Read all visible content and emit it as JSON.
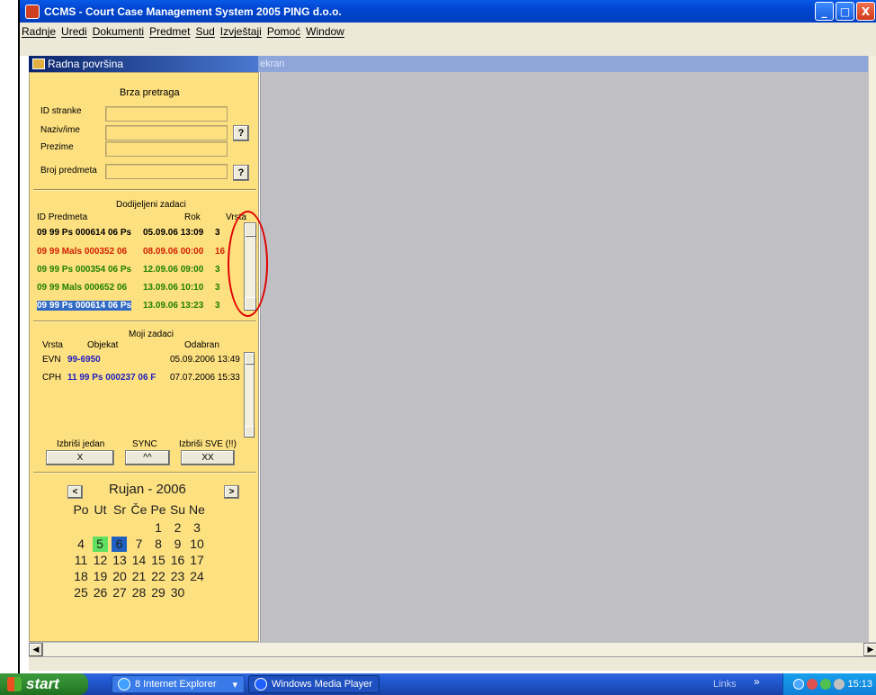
{
  "window": {
    "title": "CCMS - Court Case Management System 2005 PING d.o.o.",
    "minimize_glyph": "_",
    "maximize_glyph": "□",
    "close_glyph": "X"
  },
  "menu": [
    "Radnje",
    "Uredi",
    "Dokumenti",
    "Predmet",
    "Sud",
    "Izvještaji",
    "Pomoć",
    "Window"
  ],
  "panel": {
    "title": "Radna površina",
    "workspace_title": "ekran",
    "quick_search": {
      "heading": "Brza pretraga",
      "id_label": "ID stranke",
      "name_label": "Naziv/ime",
      "surname_label": "Prezime",
      "case_label": "Broj predmeta",
      "help_glyph": "?"
    },
    "assigned": {
      "heading": "Dodijeljeni zadaci",
      "col_id": "ID Predmeta",
      "col_deadline": "Rok",
      "col_type": "Vrsta",
      "rows": [
        {
          "id": "09 99 Ps 000614 06 Ps",
          "deadline": "05.09.06 13:09",
          "type": "3",
          "color": "#000000"
        },
        {
          "id": "09 99 Mals 000352 06",
          "deadline": "08.09.06 00:00",
          "type": "16",
          "color": "#d02000"
        },
        {
          "id": "09 99 Ps 000354 06 Ps",
          "deadline": "12.09.06 09:00",
          "type": "3",
          "color": "#208000"
        },
        {
          "id": "09 99 Mals 000652 06",
          "deadline": "13.09.06 10:10",
          "type": "3",
          "color": "#208000"
        },
        {
          "id": "09 99 Ps 000614 06 Ps",
          "deadline": "13.09.06 13:23",
          "type": "3",
          "color": "#208000"
        }
      ]
    },
    "my_tasks": {
      "heading": "Moji zadaci",
      "col_type": "Vrsta",
      "col_object": "Objekat",
      "col_selected": "Odabran",
      "rows": [
        {
          "type": "EVN",
          "object": "99-6950",
          "selected": "05.09.2006 13:49"
        },
        {
          "type": "CPH",
          "object": "11 99 Ps 000237 06 F",
          "selected": "07.07.2006 15:33"
        }
      ]
    },
    "actions": {
      "delete_one_label": "Izbriši jedan",
      "delete_one_btn": "X",
      "sync_label": "SYNC",
      "sync_btn": "^^",
      "delete_all_label": "Izbriši SVE (!!)",
      "delete_all_btn": "XX"
    },
    "calendar": {
      "prev": "<",
      "next": ">",
      "month_year": "Rujan  - 2006",
      "weekdays": [
        "Po",
        "Ut",
        "Sr",
        "Če",
        "Pe",
        "Su",
        "Ne"
      ],
      "weeks": [
        [
          "",
          "",
          "",
          "",
          "1",
          "2",
          "3"
        ],
        [
          "4",
          "5",
          "6",
          "7",
          "8",
          "9",
          "10"
        ],
        [
          "11",
          "12",
          "13",
          "14",
          "15",
          "16",
          "17"
        ],
        [
          "18",
          "19",
          "20",
          "21",
          "22",
          "23",
          "24"
        ],
        [
          "25",
          "26",
          "27",
          "28",
          "29",
          "30",
          ""
        ]
      ],
      "today_highlight": "#60e060",
      "selected_highlight": "#2060c0"
    }
  },
  "taskbar": {
    "start_label": "start",
    "items": [
      {
        "label": "8 Internet Explorer",
        "arrow": "▾"
      },
      {
        "label": "Windows Media Player"
      }
    ],
    "links_label": "Links",
    "chevrons": "»",
    "clock": "15:13"
  }
}
